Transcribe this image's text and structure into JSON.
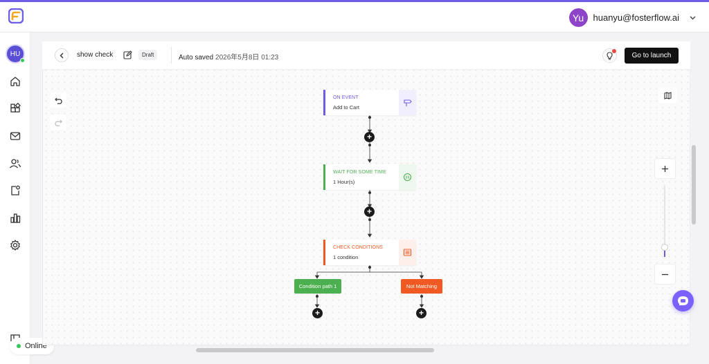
{
  "header": {
    "user_initials": "Yu",
    "user_email": "huanyu@fosterflow.ai",
    "brand_color": "#6c5ce7"
  },
  "sidebar": {
    "avatar_initials": "HU",
    "items": [
      {
        "icon": "home-icon"
      },
      {
        "icon": "apps-icon"
      },
      {
        "icon": "mail-icon"
      },
      {
        "icon": "users-icon"
      },
      {
        "icon": "tasks-icon"
      },
      {
        "icon": "chart-icon"
      },
      {
        "icon": "gear-icon"
      }
    ],
    "status_label": "Online"
  },
  "toolbar": {
    "flow_name": "show check",
    "draft_label": "Draft",
    "autosave_label": "Auto saved",
    "autosave_time": "2026年5月8日 01:23",
    "launch_label": "Go to launch"
  },
  "nodes": [
    {
      "title": "ON EVENT",
      "subtitle": "Add to Cart",
      "color": "#6c5ce7",
      "icon": "signpost-icon"
    },
    {
      "title": "WAIT FOR SOME TIME",
      "subtitle": "1 Hour(s)",
      "color": "#4caf50",
      "icon": "pause-icon"
    },
    {
      "title": "CHECK CONDITIONS",
      "subtitle": "1 condition",
      "color": "#f05a22",
      "icon": "list-icon"
    }
  ],
  "branches": [
    {
      "label": "Condition path 1",
      "color": "#4caf50"
    },
    {
      "label": "Not Matching",
      "color": "#f05a22"
    }
  ],
  "zoom": {
    "level": 0.12
  }
}
